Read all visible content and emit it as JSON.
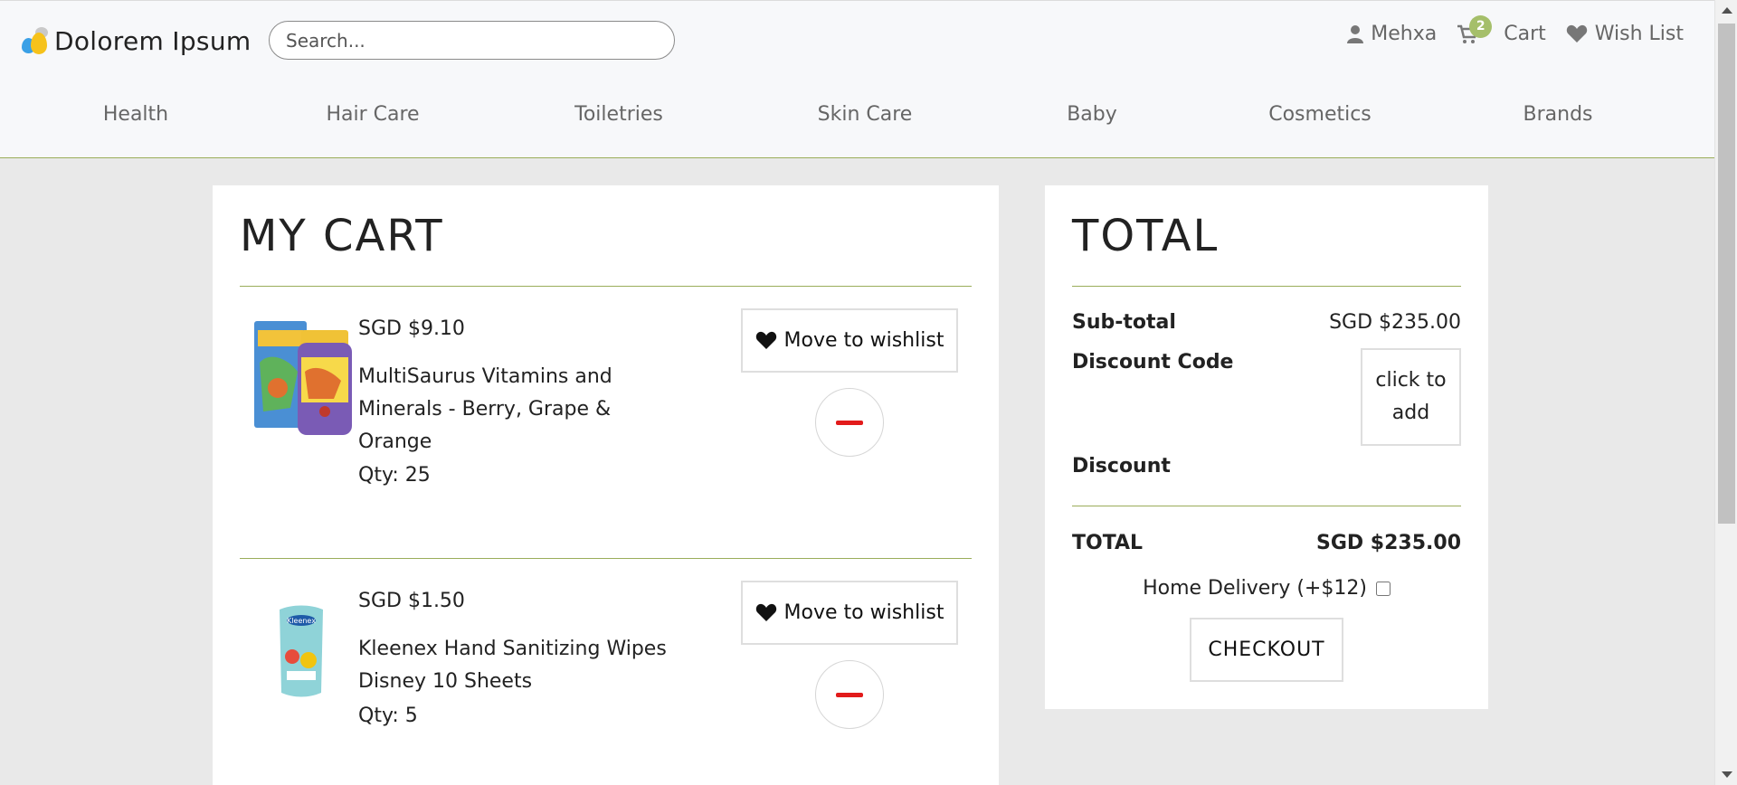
{
  "header": {
    "logo_text": "Dolorem Ipsum",
    "search_placeholder": "Search...",
    "user_label": "Mehxa",
    "cart_label": "Cart",
    "cart_count": "2",
    "wishlist_label": "Wish List"
  },
  "nav": {
    "items": [
      {
        "label": "Health"
      },
      {
        "label": "Hair Care"
      },
      {
        "label": "Toiletries"
      },
      {
        "label": "Skin Care"
      },
      {
        "label": "Baby"
      },
      {
        "label": "Cosmetics"
      },
      {
        "label": "Brands"
      }
    ]
  },
  "cart": {
    "title": "MY CART",
    "move_label": "Move to wishlist",
    "items": [
      {
        "price": "SGD $9.10",
        "name": "MultiSaurus Vitamins and Minerals - Berry, Grape & Orange",
        "qty": "Qty: 25"
      },
      {
        "price": "SGD $1.50",
        "name": "Kleenex Hand Sanitizing Wipes Disney 10 Sheets",
        "qty": "Qty: 5"
      }
    ]
  },
  "total": {
    "title": "TOTAL",
    "subtotal_label": "Sub-total",
    "subtotal_value": "SGD $235.00",
    "discount_code_label": "Discount Code",
    "discount_code_button": "click to add",
    "discount_label": "Discount",
    "total_label": "TOTAL",
    "total_value": "SGD $235.00",
    "delivery_label": "Home Delivery (+$12)",
    "delivery_checked": false,
    "checkout_label": "CHECKOUT"
  },
  "colors": {
    "accent": "#9aad5a",
    "badge": "#a5bf6a",
    "remove": "#e21b1b"
  }
}
